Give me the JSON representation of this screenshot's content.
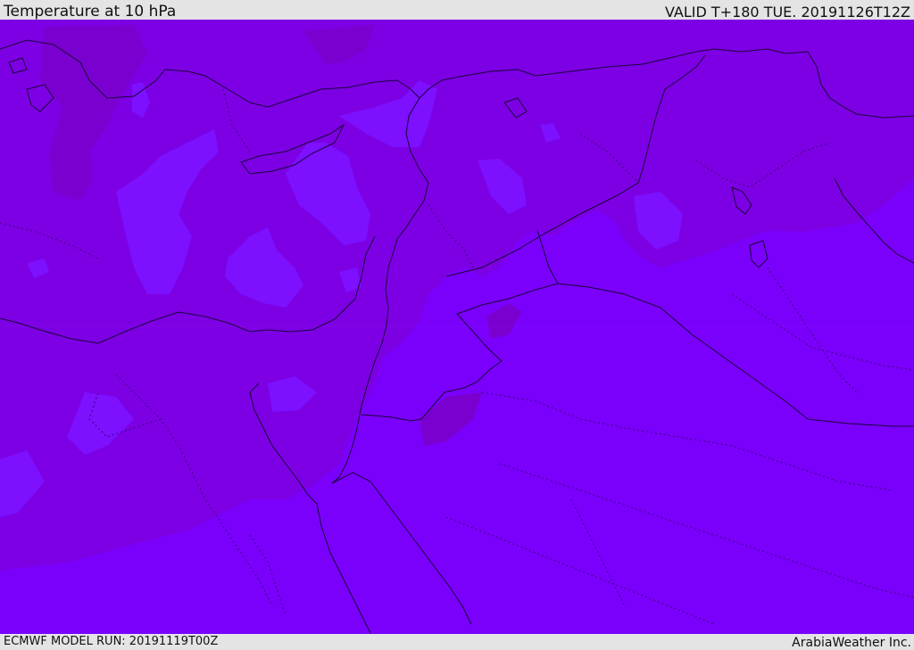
{
  "header": {
    "title": "Temperature at 10 hPa",
    "valid_time": "VALID T+180 TUE. 20191126T12Z"
  },
  "footer": {
    "model_run": "ECMWF MODEL RUN: 20191119T00Z",
    "brand": "ArabiaWeather Inc."
  },
  "colors": {
    "field_base": "#7a00fb",
    "field_warm": "#7d00e4",
    "field_warmer": "#7a00cf",
    "field_cool": "#7c10ff",
    "coastline": "#1a0038",
    "border_dotted": "#3d007a"
  }
}
